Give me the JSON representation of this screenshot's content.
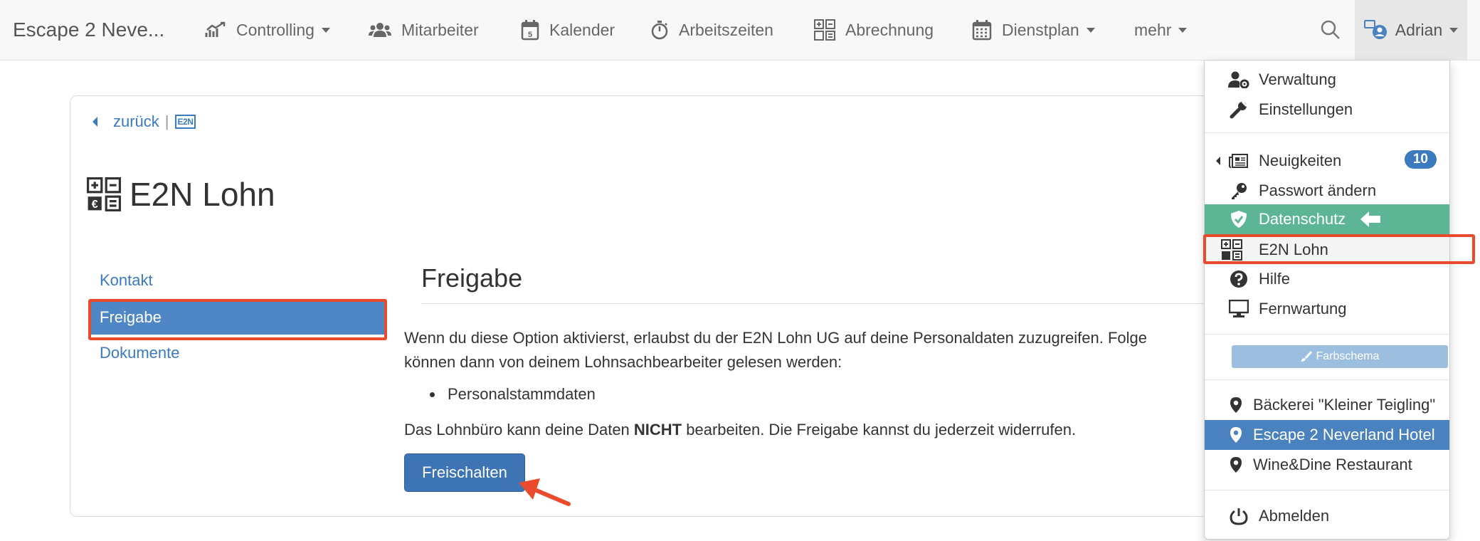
{
  "navbar": {
    "brand": "Escape 2 Neve...",
    "items": [
      {
        "label": "Controlling",
        "icon": "chart-icon",
        "dropdown": true
      },
      {
        "label": "Mitarbeiter",
        "icon": "users-icon",
        "dropdown": false
      },
      {
        "label": "Kalender",
        "icon": "calendar-day-icon",
        "calendar_day": "5",
        "dropdown": false
      },
      {
        "label": "Arbeitszeiten",
        "icon": "stopwatch-icon",
        "dropdown": false
      },
      {
        "label": "Abrechnung",
        "icon": "calculator-icon",
        "dropdown": false
      },
      {
        "label": "Dienstplan",
        "icon": "calendar-grid-icon",
        "dropdown": true
      },
      {
        "label": "mehr",
        "icon": "",
        "dropdown": true
      }
    ],
    "search_icon": "search-icon",
    "user": {
      "name": "Adrian",
      "icon": "user-circle-icon"
    }
  },
  "page": {
    "back_label": "zurück",
    "back_separator": "|",
    "back_badge": "E2N",
    "title": "E2N Lohn",
    "title_icon": "calculator-icon"
  },
  "side_nav": {
    "items": [
      {
        "label": "Kontakt",
        "active": false
      },
      {
        "label": "Freigabe",
        "active": true
      },
      {
        "label": "Dokumente",
        "active": false
      }
    ]
  },
  "content": {
    "heading": "Freigabe",
    "para1_line1": "Wenn du diese Option aktivierst, erlaubst du der E2N Lohn UG auf deine Personaldaten zuzugreifen. Folge",
    "para1_line2": "können dann von deinem Lohnsachbearbeiter gelesen werden:",
    "bullets": [
      "Personalstammdaten"
    ],
    "para2_before": "Das Lohnbüro kann deine Daten ",
    "para2_bold": "NICHT",
    "para2_after": " bearbeiten. Die Freigabe kannst du jederzeit widerrufen.",
    "button_label": "Freischalten"
  },
  "dropdown": {
    "items": [
      {
        "label": "Verwaltung",
        "icon": "user-cog-icon"
      },
      {
        "label": "Einstellungen",
        "icon": "wrench-icon"
      },
      {
        "label": "Neuigkeiten",
        "icon": "newspaper-icon",
        "badge": "10"
      },
      {
        "label": "Passwort ändern",
        "icon": "key-icon"
      },
      {
        "label": "Datenschutz",
        "icon": "shield-check-icon"
      },
      {
        "label": "E2N Lohn",
        "icon": "calculator-icon"
      },
      {
        "label": "Hilfe",
        "icon": "question-circle-icon"
      },
      {
        "label": "Fernwartung",
        "icon": "monitor-icon"
      }
    ],
    "theme_button": "Farbschema",
    "locations": [
      {
        "label": "Bäckerei \"Kleiner Teigling\"",
        "active": false
      },
      {
        "label": "Escape 2 Neverland Hotel",
        "active": true
      },
      {
        "label": "Wine&Dine Restaurant",
        "active": false
      }
    ],
    "logout": "Abmelden"
  },
  "colors": {
    "link": "#3a7bbf",
    "active_nav": "#4f87c6",
    "primary_button": "#3d74b4",
    "highlight_green": "#5cb695",
    "active_location": "#4a82c0",
    "annotation_red": "#ea4b2c"
  }
}
